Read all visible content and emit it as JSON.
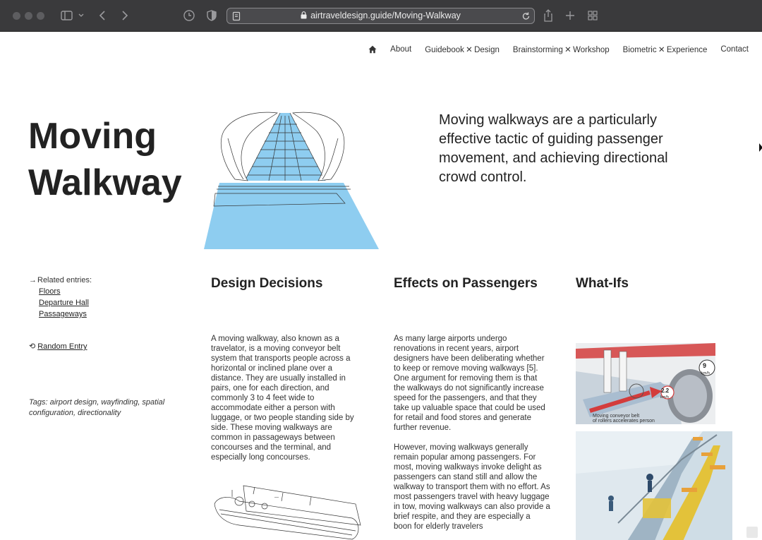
{
  "browser": {
    "url": "airtraveldesign.guide/Moving-Walkway",
    "icons": [
      "sidebar-icon",
      "back-icon",
      "forward-icon",
      "history-icon",
      "shield-icon",
      "reader-icon",
      "lock-icon",
      "reload-icon",
      "share-icon",
      "new-tab-icon",
      "tab-overview-icon"
    ]
  },
  "nav": {
    "items": [
      "About",
      "Guidebook ✕ Design",
      "Brainstorming ✕ Workshop",
      "Biometric ✕ Experience",
      "Contact"
    ]
  },
  "title": {
    "line1": "Moving",
    "line2": "Walkway"
  },
  "intro": "Moving walkways are a particularly effective tactic of guiding passenger movement, and achieving directional crowd control.",
  "related": {
    "label": "Related entries:",
    "links": [
      "Floors",
      "Departure Hall",
      "Passageways"
    ]
  },
  "random": {
    "label": "Random Entry"
  },
  "tags": {
    "prefix": "Tags:",
    "text": "airport design, wayfinding, spatial configuration, directionality"
  },
  "columns": {
    "design": {
      "heading": "Design Decisions",
      "paragraphs": [
        "A moving walkway, also known as a travelator, is a moving conveyor belt system that transports people across a horizontal or inclined plane over a distance. They are usually installed in pairs, one for each direction, and commonly 3 to 4 feet wide to accommodate either a person with luggage, or two people standing side by side. These moving walkways are common in passageways between concourses and the terminal, and especially long concourses."
      ]
    },
    "effects": {
      "heading": "Effects on Passengers",
      "paragraphs": [
        "As many large airports undergo renovations in recent years, airport designers have been deliberating whether to keep or remove moving walkways [5]. One argument for removing them is that the walkways do not significantly increase speed for the passengers, and that they take up valuable space that could be used for retail and food stores and generate further revenue.",
        "However, moving walkways generally remain popular among passengers. For most, moving walkways invoke delight as passengers can stand still and allow the walkway to transport them with no effort. As most passengers travel with heavy luggage in tow, moving walkways can also provide a brief respite, and they are especially a boon for elderly travelers"
      ]
    },
    "whatifs": {
      "heading": "What-Ifs"
    }
  },
  "image1": {
    "caption_line1": "Moving conveyor belt",
    "caption_line2": "of rollers accelerates person",
    "speed1": "9",
    "unit1": "km/h",
    "speed2": "2.2",
    "unit2": "km/h"
  },
  "colors": {
    "accent_blue": "#8ecdf0",
    "chrome": "#3a3a3c"
  }
}
